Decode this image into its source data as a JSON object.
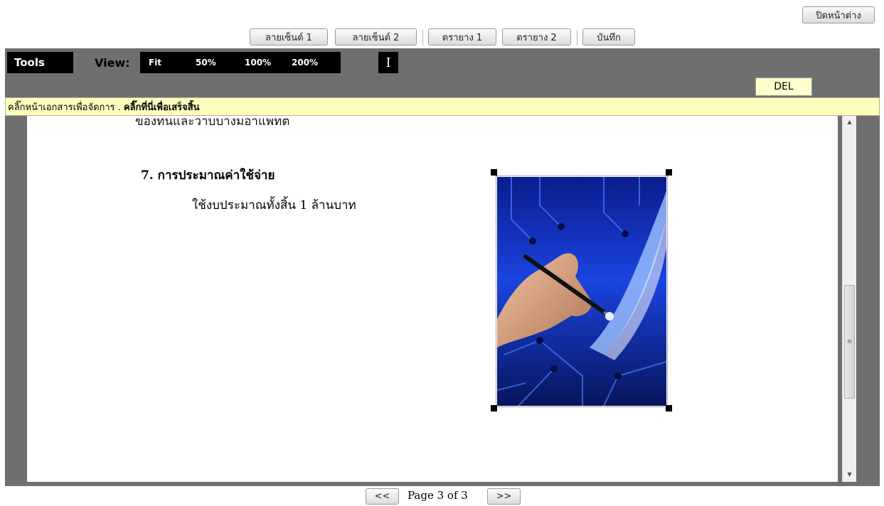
{
  "close_window_label": "ปิดหน้าต่าง",
  "toolbar": {
    "signature1": "ลายเซ็นต์ 1",
    "signature2": "ลายเซ็นต์ 2",
    "stamp1": "ตรายาง 1",
    "stamp2": "ตรายาง 2",
    "save": "บันทึก"
  },
  "viewer": {
    "tools_label": "Tools",
    "view_label": "View:",
    "view_options": [
      "Fit",
      "50%",
      "100%",
      "200%"
    ],
    "text_cursor_icon": "text-cursor-icon",
    "del_label": "DEL",
    "notice_text": "คลิ๊กหน้าเอกสารเพื่อจัดการ .",
    "notice_link": "คลิ๊กที่นี่เพื่อเสร็จสิ้น"
  },
  "document": {
    "clipped_line": "ของทนและวาบบางมอาแพทต",
    "heading": "7. การประมาณค่าใช้จ่าย",
    "body_line": "ใช้งบประมาณทั้งสิ้น 1 ล้านบาท",
    "image_subject": "hand-with-pen-digital-circuit-image"
  },
  "pager": {
    "prev": "<<",
    "page_text": "Page 3 of 3",
    "next": ">>"
  },
  "colors": {
    "viewer_bg": "#6f6f6f",
    "notice_bg": "#ffffc0",
    "del_bg": "#ffffcc",
    "accent_blue": "#1a3cc8"
  }
}
